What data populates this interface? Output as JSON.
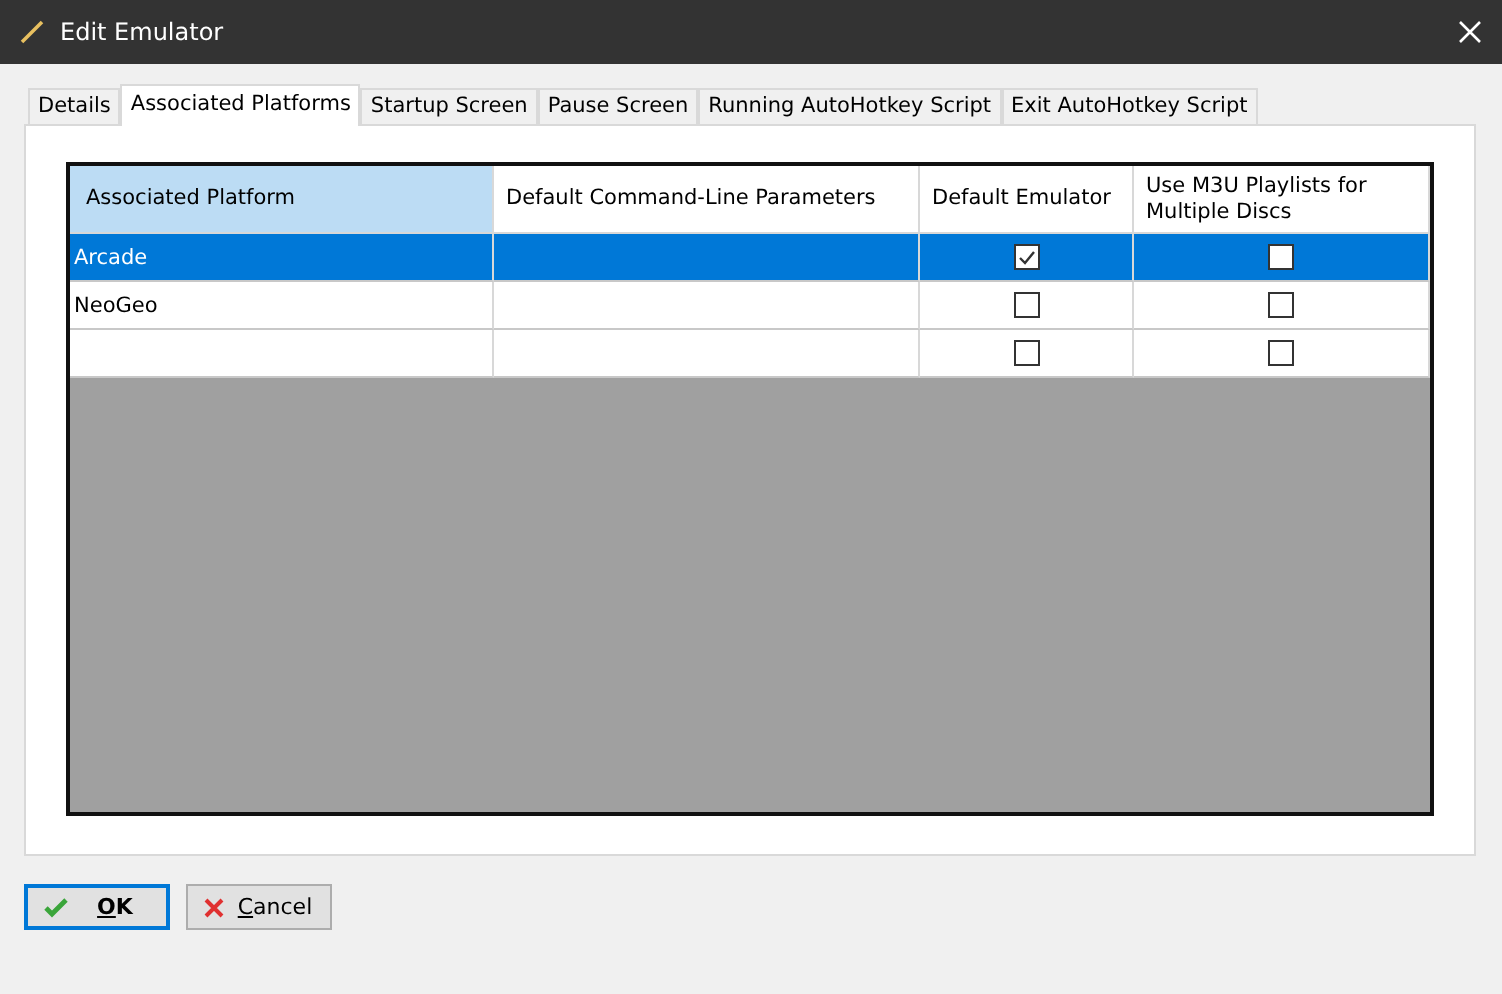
{
  "window": {
    "title": "Edit Emulator"
  },
  "tabs": [
    {
      "label": "Details",
      "selected": false
    },
    {
      "label": "Associated Platforms",
      "selected": true
    },
    {
      "label": "Startup Screen",
      "selected": false
    },
    {
      "label": "Pause Screen",
      "selected": false
    },
    {
      "label": "Running AutoHotkey Script",
      "selected": false
    },
    {
      "label": "Exit AutoHotkey Script",
      "selected": false
    }
  ],
  "table": {
    "columns": [
      {
        "label": "Associated Platform",
        "selected": true
      },
      {
        "label": "Default Command-Line Parameters",
        "selected": false
      },
      {
        "label": "Default Emulator",
        "selected": false
      },
      {
        "label": "Use M3U Playlists for Multiple Discs",
        "selected": false
      }
    ],
    "rows": [
      {
        "platform": "Arcade",
        "selected": true,
        "default_emulator": true,
        "use_m3u": false
      },
      {
        "platform": "NeoGeo",
        "selected": false,
        "default_emulator": false,
        "use_m3u": false
      },
      {
        "selected": false,
        "default_emulator": false,
        "use_m3u": false
      }
    ]
  },
  "buttons": [
    {
      "label": "OK",
      "kind": "ok",
      "focused": true
    },
    {
      "label": "Cancel",
      "kind": "cancel",
      "focused": false
    }
  ]
}
